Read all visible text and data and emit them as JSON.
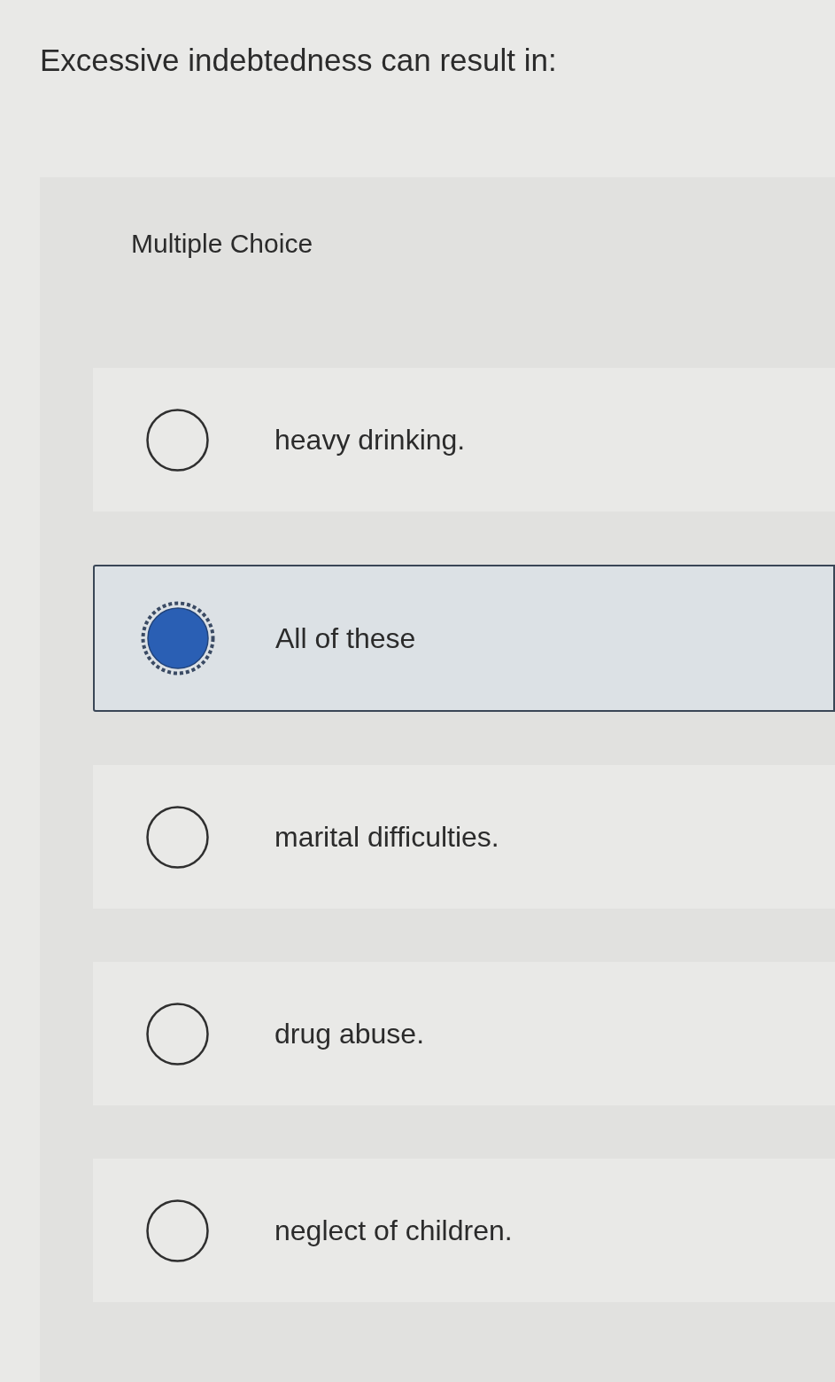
{
  "question": {
    "text": "Excessive indebtedness can result in:"
  },
  "answer_panel": {
    "type_label": "Multiple Choice",
    "options": [
      {
        "label": "heavy drinking.",
        "selected": false
      },
      {
        "label": "All of these",
        "selected": true
      },
      {
        "label": "marital difficulties.",
        "selected": false
      },
      {
        "label": "drug abuse.",
        "selected": false
      },
      {
        "label": "neglect of children.",
        "selected": false
      }
    ]
  }
}
